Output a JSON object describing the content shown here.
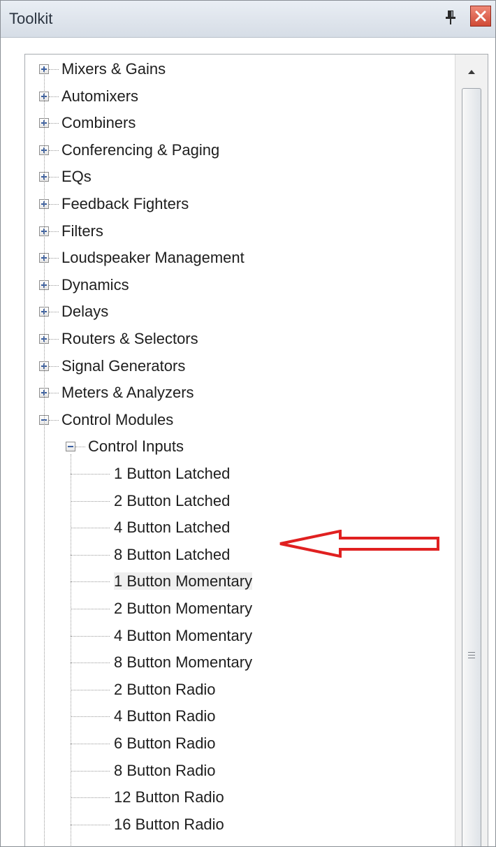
{
  "window": {
    "title": "Toolkit"
  },
  "tree": {
    "categories": [
      "Mixers & Gains",
      "Automixers",
      "Combiners",
      "Conferencing & Paging",
      "EQs",
      "Feedback Fighters",
      "Filters",
      "Loudspeaker Management",
      "Dynamics",
      "Delays",
      "Routers & Selectors",
      "Signal Generators",
      "Meters & Analyzers"
    ],
    "expanded_category": "Control Modules",
    "expanded_subcategory": "Control Inputs",
    "items": [
      "1 Button Latched",
      "2 Button Latched",
      "4 Button Latched",
      "8 Button Latched",
      "1 Button Momentary",
      "2 Button Momentary",
      "4 Button Momentary",
      "8 Button Momentary",
      "2 Button Radio",
      "4 Button Radio",
      "6 Button Radio",
      "8 Button Radio",
      "12 Button Radio",
      "16 Button Radio"
    ],
    "highlighted_item": "1 Button Momentary"
  },
  "icons": {
    "pin": "pin-icon",
    "close": "close-icon",
    "expand": "plus-box-icon",
    "collapse": "minus-box-icon",
    "scroll_up": "scroll-up-arrow-icon",
    "annotation": "red-arrow-icon"
  },
  "colors": {
    "annotation": "#e02020",
    "close_button": "#d04a36"
  }
}
